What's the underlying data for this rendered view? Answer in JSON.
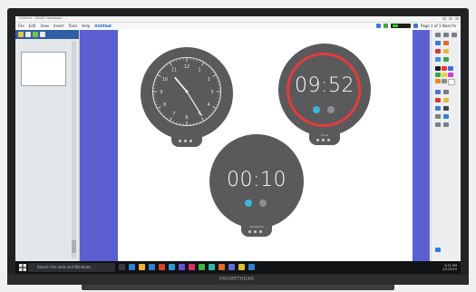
{
  "app": {
    "title": "Untitled - SMART Notebook",
    "menus": [
      "File",
      "Edit",
      "View",
      "Insert",
      "Tools",
      "Help"
    ],
    "document": "Untitled",
    "page_counter": "Page 1 of 1  Next Pa"
  },
  "clock": {
    "hour_hand_deg": 320,
    "minute_hand_deg": 148,
    "numerals": [
      "12",
      "1",
      "2",
      "3",
      "4",
      "5",
      "6",
      "7",
      "8",
      "9",
      "10",
      "11"
    ]
  },
  "timer_top": {
    "display": "09:52",
    "ring_color": "#e63b3b",
    "label": "Timer"
  },
  "timer_bottom": {
    "display": "00:10",
    "label": "Stopwatch"
  },
  "taskbar": {
    "search_placeholder": "Search the web and Windows",
    "time": "3:32 PM",
    "date": "2/1/2019"
  },
  "brand": "PROMETHEAN",
  "colors": {
    "background_blue": "#5b5fd0",
    "widget_gray": "#5a5a5c",
    "accent_cyan": "#3fb6d9",
    "timer_red": "#e63b3b"
  }
}
